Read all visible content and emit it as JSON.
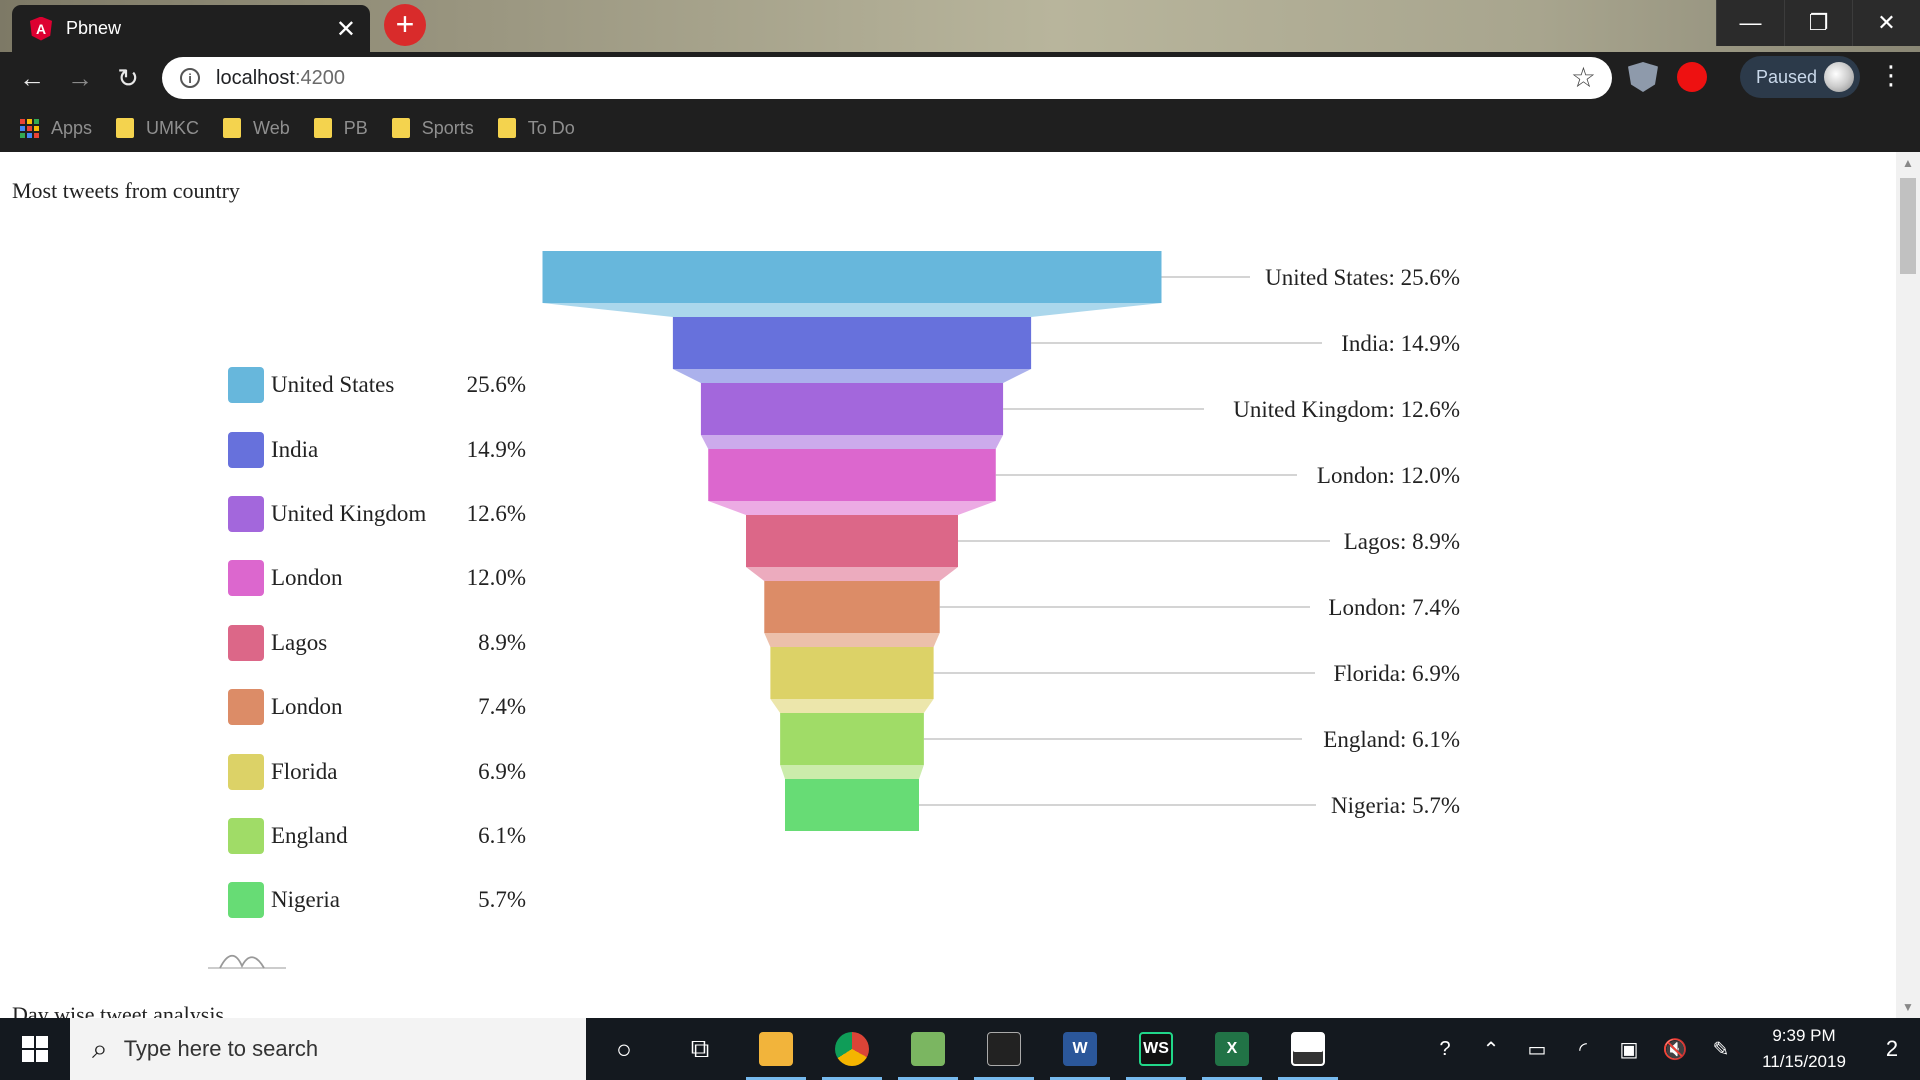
{
  "browser": {
    "tab_title": "Pbnew",
    "tab_favicon": "A",
    "url_host": "localhost",
    "url_port": ":4200",
    "profile_status": "Paused",
    "bookmarks": [
      {
        "label": "Apps",
        "icon": "apps-grid-icon"
      },
      {
        "label": "UMKC",
        "icon": "folder-icon"
      },
      {
        "label": "Web",
        "icon": "folder-icon"
      },
      {
        "label": "PB",
        "icon": "folder-icon"
      },
      {
        "label": "Sports",
        "icon": "folder-icon"
      },
      {
        "label": "To Do",
        "icon": "folder-icon"
      }
    ]
  },
  "page": {
    "title": "Most tweets from country",
    "next_section_title": "Day wise tweet analysis"
  },
  "chart_data": {
    "type": "funnel",
    "title": "Most tweets from country",
    "series": [
      {
        "name": "United States",
        "value": 25.6,
        "label": "United States: 25.6%",
        "display": "25.6%",
        "color": "#67b7dc"
      },
      {
        "name": "India",
        "value": 14.9,
        "label": "India: 14.9%",
        "display": "14.9%",
        "color": "#6771dc"
      },
      {
        "name": "United Kingdom",
        "value": 12.6,
        "label": "United Kingdom: 12.6%",
        "display": "12.6%",
        "color": "#a367dc"
      },
      {
        "name": "London",
        "value": 12.0,
        "label": "London: 12.0%",
        "display": "12.0%",
        "color": "#dc67ce"
      },
      {
        "name": "Lagos",
        "value": 8.9,
        "label": "Lagos: 8.9%",
        "display": "8.9%",
        "color": "#dc6788"
      },
      {
        "name": "London",
        "value": 7.4,
        "label": "London: 7.4%",
        "display": "7.4%",
        "color": "#dc8c67"
      },
      {
        "name": "Florida",
        "value": 6.9,
        "label": "Florida: 6.9%",
        "display": "6.9%",
        "color": "#dcd267"
      },
      {
        "name": "England",
        "value": 6.1,
        "label": "England: 6.1%",
        "display": "6.1%",
        "color": "#a0dc67"
      },
      {
        "name": "Nigeria",
        "value": 5.7,
        "label": "Nigeria: 5.7%",
        "display": "5.7%",
        "color": "#67dc75"
      }
    ],
    "legend_position": "left",
    "labels_position": "right"
  },
  "taskbar": {
    "search_placeholder": "Type here to search",
    "time": "9:39 PM",
    "date": "11/15/2019",
    "notification_count": "2",
    "apps": [
      {
        "name": "file-explorer-icon",
        "label": ""
      },
      {
        "name": "chrome-icon",
        "label": ""
      },
      {
        "name": "image-editor-icon",
        "label": ""
      },
      {
        "name": "terminal-icon",
        "label": ""
      },
      {
        "name": "word-icon",
        "label": "W"
      },
      {
        "name": "webstorm-icon",
        "label": "WS"
      },
      {
        "name": "excel-icon",
        "label": "X"
      },
      {
        "name": "photos-icon",
        "label": ""
      }
    ]
  }
}
